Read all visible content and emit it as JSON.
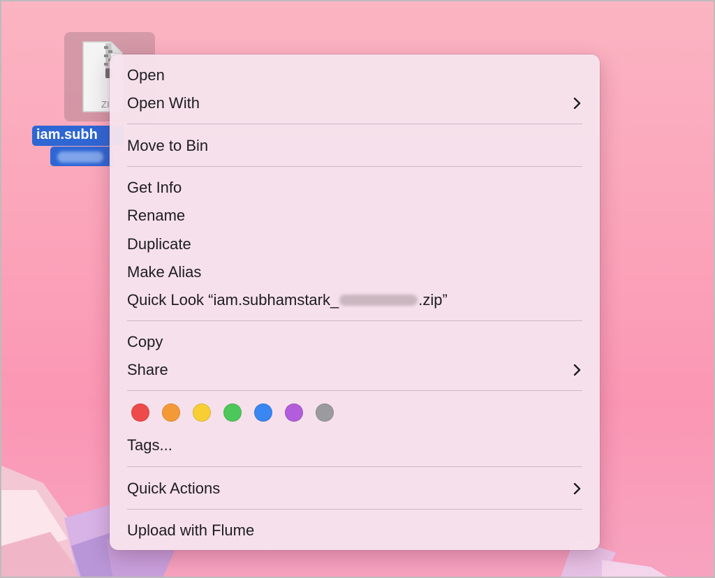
{
  "desktop": {
    "file": {
      "name_visible": "iam.subh",
      "type_badge": "ZI"
    }
  },
  "menu": {
    "open": "Open",
    "open_with": "Open With",
    "move_to_bin": "Move to Bin",
    "get_info": "Get Info",
    "rename": "Rename",
    "duplicate": "Duplicate",
    "make_alias": "Make Alias",
    "quick_look_prefix": "Quick Look “iam.subhamstark_",
    "quick_look_suffix": ".zip”",
    "copy": "Copy",
    "share": "Share",
    "tags": "Tags...",
    "quick_actions": "Quick Actions",
    "upload_flume": "Upload with Flume"
  },
  "tag_colors": {
    "red": "#ee4a4a",
    "orange": "#f39a37",
    "yellow": "#f7cf34",
    "green": "#4cc85a",
    "blue": "#3a86f2",
    "purple": "#b25ddb",
    "gray": "#9b9b9f"
  },
  "colors": {
    "menu_background": "#f6e2ec",
    "selection_blue": "#2e66d4",
    "desktop_pink": "#fba4ba"
  }
}
